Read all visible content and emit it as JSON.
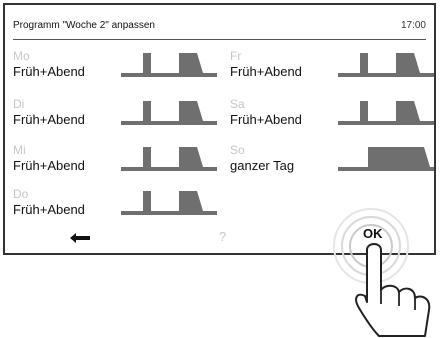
{
  "header": {
    "title": "Programm \"Woche 2\" anpassen",
    "time": "17:00"
  },
  "days": [
    {
      "name": "Mo",
      "mode": "Früh+Abend",
      "profile": "two-blocks"
    },
    {
      "name": "Di",
      "mode": "Früh+Abend",
      "profile": "two-blocks"
    },
    {
      "name": "Mi",
      "mode": "Früh+Abend",
      "profile": "two-blocks"
    },
    {
      "name": "Do",
      "mode": "Früh+Abend",
      "profile": "two-blocks"
    },
    {
      "name": "Fr",
      "mode": "Früh+Abend",
      "profile": "two-blocks"
    },
    {
      "name": "Sa",
      "mode": "Früh+Abend",
      "profile": "two-blocks"
    },
    {
      "name": "So",
      "mode": "ganzer Tag",
      "profile": "all-day"
    }
  ],
  "footer": {
    "back_icon": "back-arrow-icon",
    "help_label": "?",
    "ok_label": "OK"
  },
  "colors": {
    "profile_fill": "#6f6f6f",
    "day_name": "#c7c7c7",
    "frame": "#333333"
  }
}
